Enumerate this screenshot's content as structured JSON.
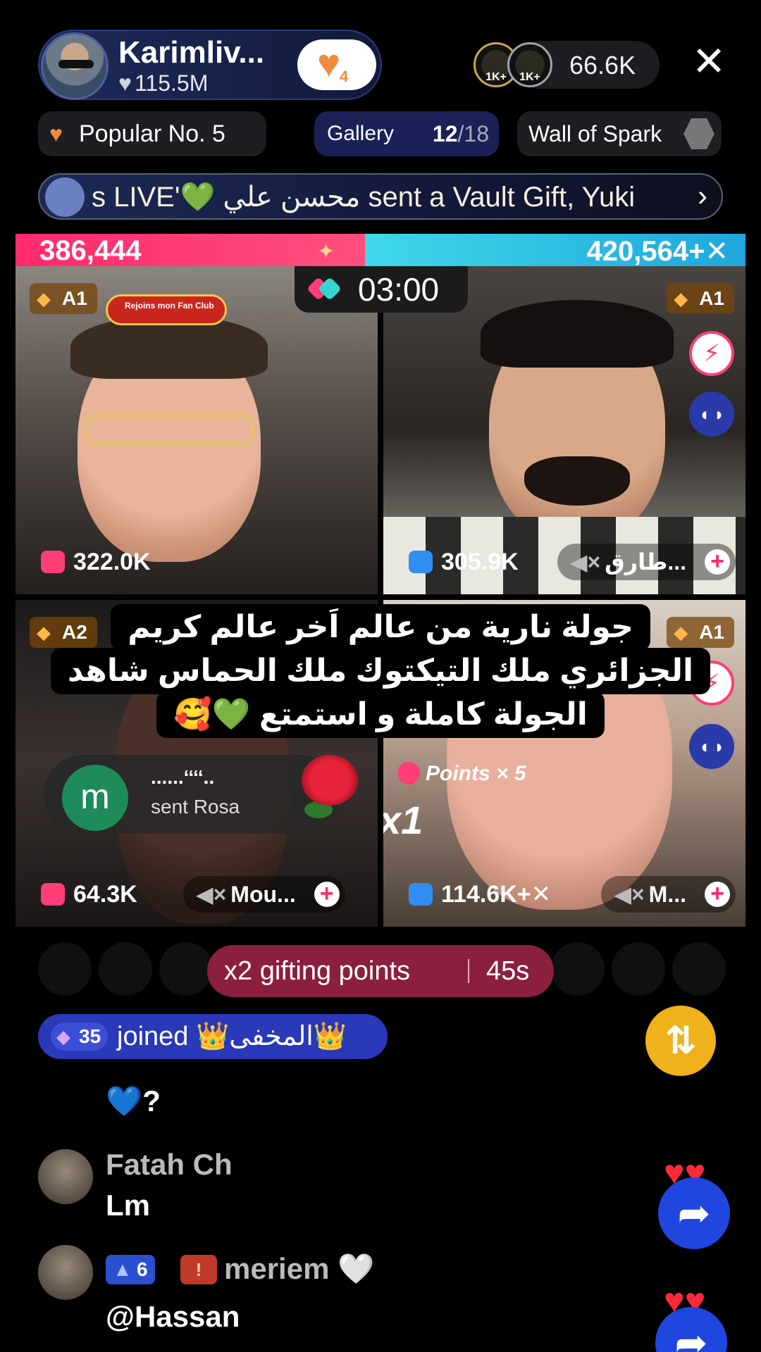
{
  "host": {
    "name": "Karimliv...",
    "likes": "115.5M",
    "follow_count": "4"
  },
  "viewers": {
    "badges": [
      "1K+",
      "1K+"
    ],
    "count": "66.6K"
  },
  "chips": {
    "popular": "Popular No. 5",
    "gallery_label": "Gallery",
    "gallery_current": "12",
    "gallery_total": "/18",
    "wall": "Wall of Spark"
  },
  "ticker": {
    "text": "s LIVE'💚 محسن علي sent a Vault Gift, Yuki"
  },
  "battle": {
    "left_score": "386,444",
    "right_score": "420,564+✕",
    "left_share": 0.479,
    "timer": "03:00"
  },
  "tiles": [
    {
      "rank": "A1",
      "score": "322.0K",
      "fan_club": "Rejoins mon Fan Club"
    },
    {
      "rank": "A1",
      "score": "305.9K",
      "name": "طارق..."
    },
    {
      "rank": "A2",
      "score": "64.3K",
      "name": "Mou..."
    },
    {
      "rank": "A1",
      "score": "114.6K+✕",
      "name": "M...",
      "points": "Points × 5",
      "multiplier": "x1"
    }
  ],
  "gift_notice": {
    "avatar_letter": "m",
    "user": "......‘‘‘‘..",
    "message": "sent Rosa"
  },
  "caption": [
    "جولة نارية من عالم اَخر عالم كريم",
    "الجزائري ملك التيكتوك ملك الحماس شاهد",
    "الجولة كاملة و استمتع 💚🥰"
  ],
  "gifting": {
    "text": "x2 gifting points",
    "time": "45s"
  },
  "joined": {
    "level": "35",
    "text": "joined 👑المخفى👑"
  },
  "chat": [
    {
      "message": "💙?"
    },
    {
      "user": "Fatah Ch",
      "message": "Lm"
    },
    {
      "level": "6",
      "user": "meriem 🤍",
      "message": "@Hassan"
    }
  ],
  "icons": {
    "close": "close-icon",
    "heart": "heart-icon",
    "share": "share-arrow-icon",
    "repost": "repost-icon"
  }
}
